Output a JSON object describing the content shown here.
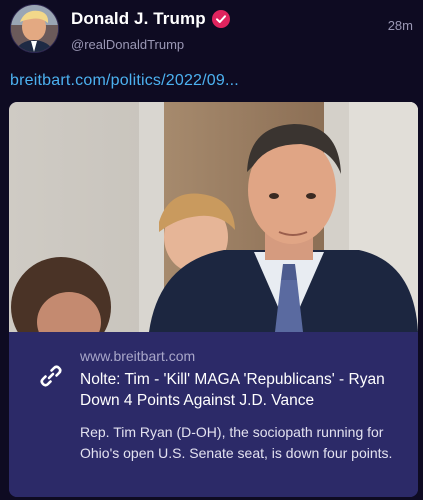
{
  "post": {
    "author": {
      "display_name": "Donald J. Trump",
      "handle": "@realDonaldTrump",
      "verified_icon": "verified-badge-icon",
      "verified_color": "#e0245e"
    },
    "timestamp": "28m",
    "link_text": "breitbart.com/politics/2022/09...",
    "card": {
      "domain": "www.breitbart.com",
      "title": "Nolte: Tim - 'Kill' MAGA 'Republicans' - Ryan Down 4 Points Against J.D. Vance",
      "description": "Rep. Tim Ryan (D-OH), the sociopath running for Ohio's open U.S. Senate seat, is down four points.",
      "link_icon": "link-chain-icon"
    }
  },
  "colors": {
    "background": "#0e0b22",
    "link": "#4cb1f0",
    "card_background": "#2c2a68",
    "muted_text": "#9a97b4"
  }
}
